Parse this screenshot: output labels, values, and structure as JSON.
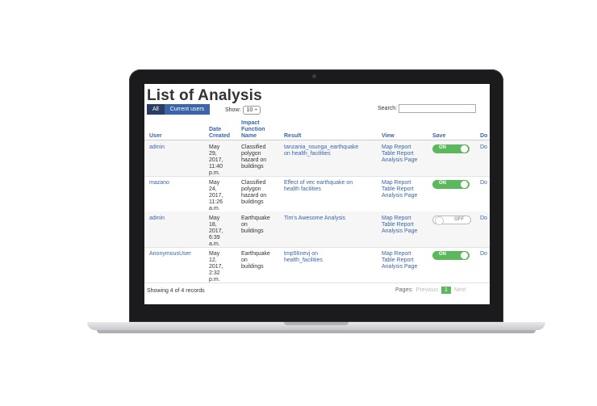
{
  "page": {
    "title": "List of Analysis",
    "filters": [
      "All",
      "Current users"
    ],
    "show_label": "Show:",
    "show_value": "10 ÷",
    "search_label": "Search:",
    "search_value": ""
  },
  "columns": {
    "user": "User",
    "date_l1": "Date",
    "date_l2": "Created",
    "ifn_l1": "Impact",
    "ifn_l2": "Function",
    "ifn_l3": "Name",
    "result": "Result",
    "view": "View",
    "save": "Save",
    "download": "Do"
  },
  "rows": [
    {
      "user": "admin",
      "date": [
        "May",
        "29,",
        "2017,",
        "11:40",
        "p.m."
      ],
      "ifn": [
        "Classified",
        "polygon",
        "hazard on",
        "buildings"
      ],
      "result": [
        "tanzania_nsunga_earthquake",
        "on health_facilities"
      ],
      "views": [
        "Map Report",
        "Table Report",
        "Analysis Page"
      ],
      "save": "ON",
      "download": "Do"
    },
    {
      "user": "mazano",
      "date": [
        "May",
        "24,",
        "2017,",
        "11:26",
        "a.m."
      ],
      "ifn": [
        "Classified",
        "polygon",
        "hazard on",
        "buildings"
      ],
      "result": [
        "Effect of vec earthquake on",
        "health facilities"
      ],
      "views": [
        "Map Report",
        "Table Report",
        "Analysis Page"
      ],
      "save": "ON",
      "download": "Do"
    },
    {
      "user": "admin",
      "date": [
        "May",
        "18,",
        "2017,",
        "6:39",
        "a.m."
      ],
      "ifn": [
        "Earthquake",
        "on",
        "buildings"
      ],
      "result": [
        "Tim's Awesome Analysis"
      ],
      "views": [
        "Map Report",
        "Table Report",
        "Analysis Page"
      ],
      "save": "OFF",
      "download": "Do"
    },
    {
      "user": "AnonymousUser",
      "date": [
        "May",
        "12,",
        "2017,",
        "2:32",
        "p.m."
      ],
      "ifn": [
        "Earthquake",
        "on",
        "buildings"
      ],
      "result": [
        "tmp56nevj on",
        "health_facilities"
      ],
      "views": [
        "Map Report",
        "Table Report",
        "Analysis Page"
      ],
      "save": "ON",
      "download": "Do"
    }
  ],
  "footer": {
    "records": "Showing 4 of 4 records",
    "pages_label": "Pages:",
    "previous": "Previous",
    "current_page": "1",
    "next": "Next"
  }
}
